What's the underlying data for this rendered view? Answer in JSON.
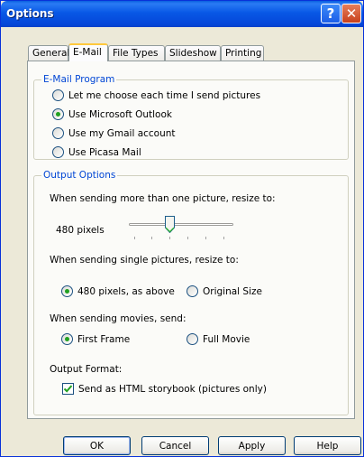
{
  "window": {
    "title": "Options",
    "help_glyph": "?",
    "close_glyph": "✕"
  },
  "tabs": [
    {
      "label": "General",
      "active": false
    },
    {
      "label": "E-Mail",
      "active": true
    },
    {
      "label": "File Types",
      "active": false
    },
    {
      "label": "Slideshow",
      "active": false
    },
    {
      "label": "Printing",
      "active": false
    }
  ],
  "email_program": {
    "title": "E-Mail Program",
    "options": [
      {
        "label": "Let me choose each time I send pictures",
        "checked": false
      },
      {
        "label": "Use Microsoft Outlook",
        "checked": true
      },
      {
        "label": "Use my Gmail account",
        "checked": false
      },
      {
        "label": "Use Picasa Mail",
        "checked": false
      }
    ]
  },
  "output_options": {
    "title": "Output Options",
    "multi_resize_label": "When sending more than one picture, resize to:",
    "slider_value_label": "480 pixels",
    "single_resize_label": "When sending single pictures, resize to:",
    "single_opt1": "480 pixels, as above",
    "single_opt2": "Original Size",
    "movies_label": "When sending movies, send:",
    "movie_opt1": "First Frame",
    "movie_opt2": "Full Movie",
    "format_label": "Output Format:",
    "html_checkbox": "Send as HTML storybook (pictures only)",
    "html_checked": true
  },
  "buttons": {
    "ok": "OK",
    "cancel": "Cancel",
    "apply": "Apply",
    "help": "Help"
  },
  "colors": {
    "titlebar": "#0858e6",
    "group_title": "#0046d5",
    "radio_dot": "#21a121"
  }
}
